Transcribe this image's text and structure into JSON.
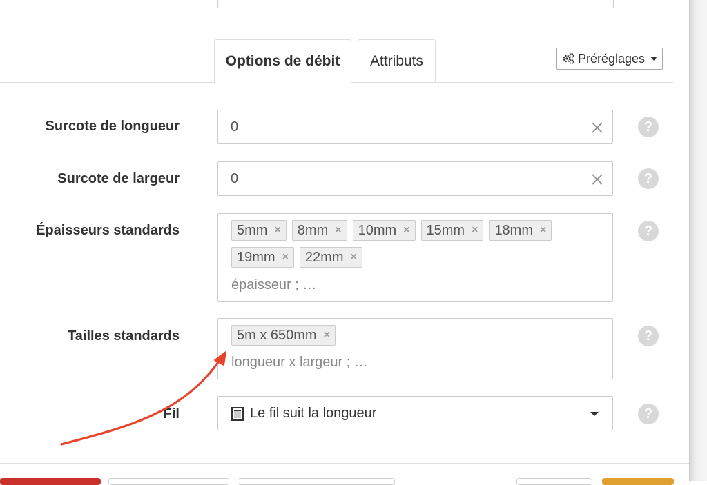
{
  "tabs": [
    {
      "label": "Options de débit",
      "active": true
    },
    {
      "label": "Attributs",
      "active": false
    }
  ],
  "presets": {
    "label": "Préréglages",
    "icon": "gears-icon"
  },
  "fields": {
    "length_overcut": {
      "label": "Surcote de longueur",
      "value": "0"
    },
    "width_overcut": {
      "label": "Surcote de largeur",
      "value": "0"
    },
    "thicknesses": {
      "label": "Épaisseurs standards",
      "tags": [
        "5mm",
        "8mm",
        "10mm",
        "15mm",
        "18mm",
        "19mm",
        "22mm"
      ],
      "placeholder": "épaisseur ; …"
    },
    "sizes": {
      "label": "Tailles standards",
      "tags": [
        "5m x 650mm"
      ],
      "placeholder": "longueur x largeur ; …"
    },
    "grain": {
      "label": "Fil",
      "value": "Le fil suit la longueur",
      "icon": "grain-lines-icon"
    }
  },
  "help_glyph": "?",
  "tag_remove_glyph": "×",
  "colors": {
    "annotation_arrow": "#e8432b",
    "footer_red": "#c9302c",
    "footer_orange": "#e0a030"
  }
}
